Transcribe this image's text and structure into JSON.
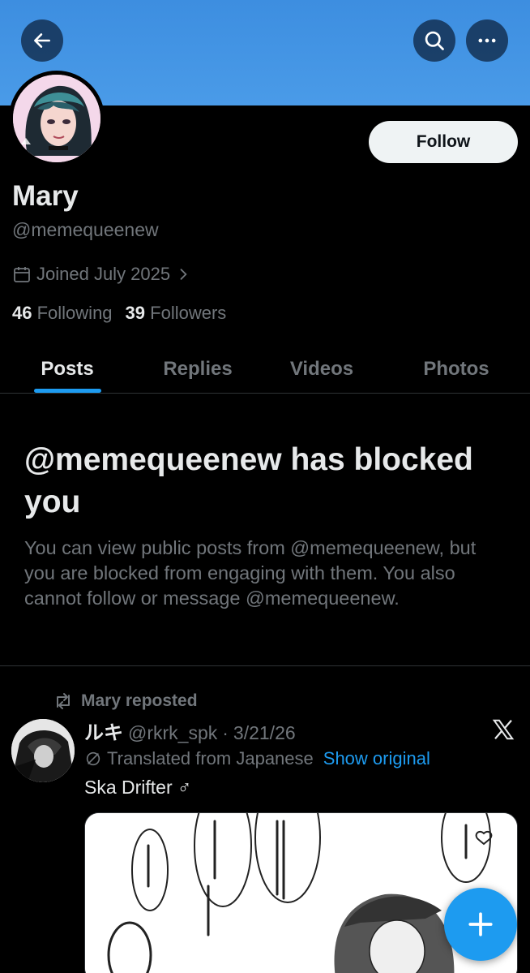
{
  "header": {
    "back_icon": "arrow-left-icon",
    "search_icon": "search-icon",
    "more_icon": "more-horizontal-icon",
    "banner_color": "#4a9be8"
  },
  "profile": {
    "follow_label": "Follow",
    "display_name": "Mary",
    "handle": "@memequeenew",
    "joined": "Joined July 2025",
    "following_count": "46",
    "following_label": "Following",
    "followers_count": "39",
    "followers_label": "Followers"
  },
  "tabs": [
    {
      "label": "Posts",
      "active": true
    },
    {
      "label": "Replies",
      "active": false
    },
    {
      "label": "Videos",
      "active": false
    },
    {
      "label": "Photos",
      "active": false
    }
  ],
  "blocked": {
    "title": "@memequeenew has blocked you",
    "text": "You can view public posts from @memequeenew, but you are blocked from engaging with them. You also cannot follow or message @memequeenew."
  },
  "post": {
    "repost_label": "Mary reposted",
    "author_name": "ルキ",
    "author_handle": "@rkrk_spk",
    "separator": "·",
    "date": "3/21/26",
    "translated_label": "Translated from Japanese",
    "show_original": "Show original",
    "text": "Ska Drifter ♂"
  },
  "colors": {
    "accent": "#1d9bf0",
    "background": "#000000",
    "muted_text": "#71767b",
    "primary_text": "#e7e9ea"
  }
}
